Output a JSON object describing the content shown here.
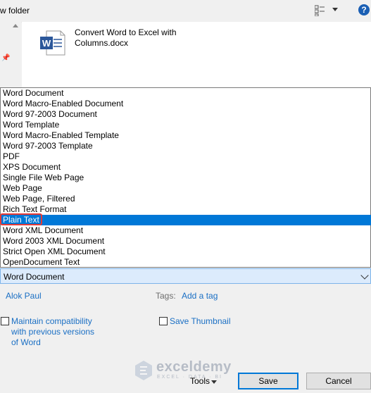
{
  "toolbar": {
    "new_folder_label": "w folder",
    "help_label": "?"
  },
  "file": {
    "name": "Convert Word to Excel with Columns.docx"
  },
  "save_as_type": {
    "options": [
      "Word Document",
      "Word Macro-Enabled Document",
      "Word 97-2003 Document",
      "Word Template",
      "Word Macro-Enabled Template",
      "Word 97-2003 Template",
      "PDF",
      "XPS Document",
      "Single File Web Page",
      "Web Page",
      "Web Page, Filtered",
      "Rich Text Format",
      "Plain Text",
      "Word XML Document",
      "Word 2003 XML Document",
      "Strict Open XML Document",
      "OpenDocument Text"
    ],
    "highlighted": "Plain Text",
    "selected_value": "Word Document"
  },
  "meta": {
    "author": "Alok Paul",
    "tags_label": "Tags:",
    "add_tag": "Add a tag"
  },
  "options": {
    "maintain_compat": "Maintain compatibility with previous versions of Word",
    "save_thumbnail": "Save Thumbnail"
  },
  "watermark": {
    "name": "exceldemy",
    "tagline": "EXCEL · DATA · BI"
  },
  "buttons": {
    "tools": "Tools",
    "save": "Save",
    "cancel": "Cancel"
  },
  "colors": {
    "selection": "#0078d7",
    "link": "#1a6fc4",
    "highlight_border": "#e53935"
  }
}
